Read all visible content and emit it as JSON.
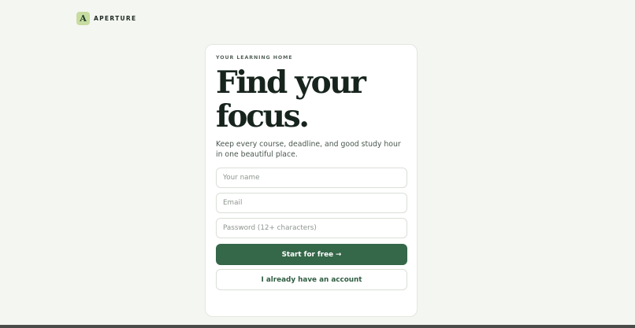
{
  "brand": {
    "logo_letter": "A",
    "name": "APERTURE"
  },
  "card": {
    "eyebrow": "YOUR LEARNING HOME",
    "headline_line1": "Find your",
    "headline_line2": "focus.",
    "subtext": "Keep every course, deadline, and good study hour in one beautiful place."
  },
  "form": {
    "name_placeholder": "Your name",
    "email_placeholder": "Email",
    "password_placeholder": "Password (12+ characters)",
    "primary_label": "Start for free",
    "primary_arrow": "→",
    "secondary_label": "I already have an account"
  },
  "colors": {
    "background": "#f4f6f1",
    "brand_mark": "#c7dca0",
    "primary_button": "#356749",
    "heading": "#17241d"
  },
  "icons": {
    "logo": "logo-mark-icon",
    "arrow": "arrow-right-icon"
  }
}
